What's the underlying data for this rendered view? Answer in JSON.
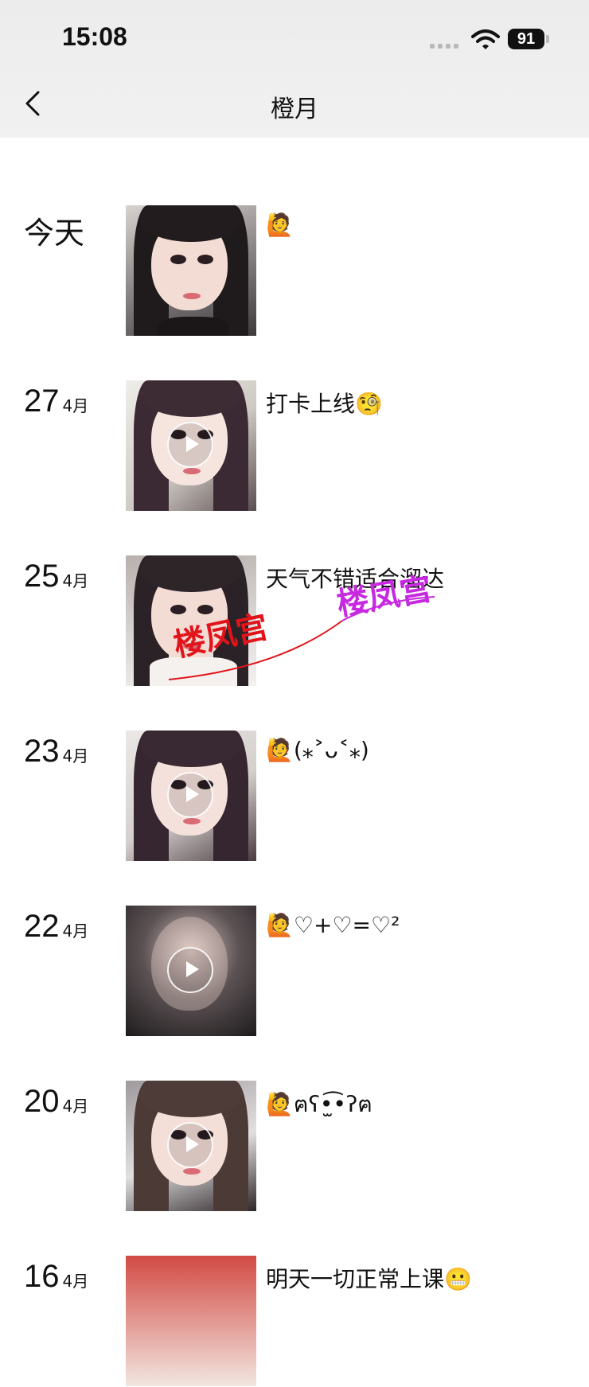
{
  "status_bar": {
    "time": "15:08",
    "battery": "91"
  },
  "header": {
    "title": "橙月",
    "back_icon": "chevron-left-icon"
  },
  "entries": [
    {
      "day": "今天",
      "month": "",
      "media": "photo",
      "caption": "🙋"
    },
    {
      "day": "27",
      "month": "4月",
      "media": "video",
      "caption": "打卡上线🧐"
    },
    {
      "day": "25",
      "month": "4月",
      "media": "photo",
      "caption": "天气不错适合溜达"
    },
    {
      "day": "23",
      "month": "4月",
      "media": "video",
      "caption": "🙋(⁎˃ᴗ˂⁎)"
    },
    {
      "day": "22",
      "month": "4月",
      "media": "video",
      "caption": "🙋♡+♡=♡²"
    },
    {
      "day": "20",
      "month": "4月",
      "media": "video",
      "caption": "🙋ฅʕ•̫͡•ʔฅ"
    },
    {
      "day": "16",
      "month": "4月",
      "media": "photo",
      "caption": "明天一切正常上课😬"
    }
  ],
  "watermark": {
    "text_red": "楼凤宫",
    "text_purple": "楼凤宫",
    "red": "#e1141b",
    "purple": "#c629e0"
  }
}
